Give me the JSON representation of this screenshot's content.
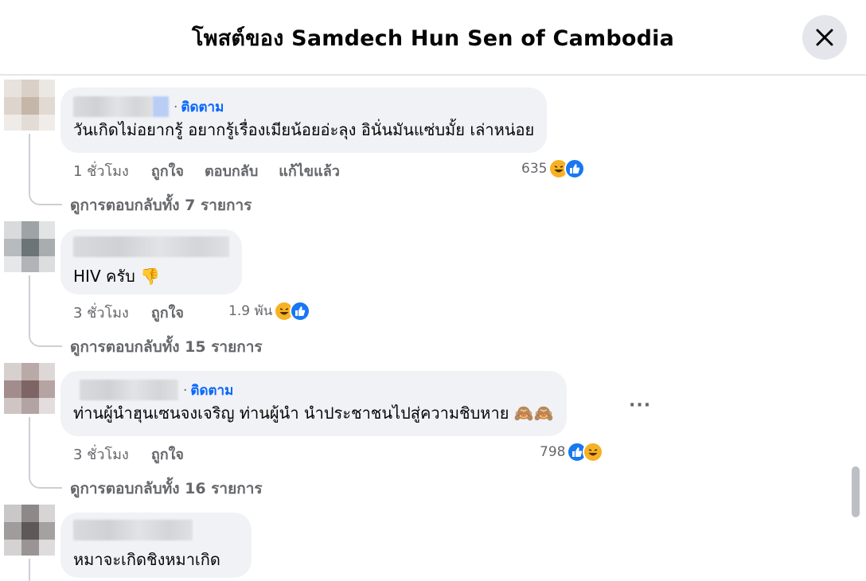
{
  "header": {
    "title": "โพสต์ของ Samdech Hun Sen of Cambodia",
    "close_icon": "close-icon"
  },
  "comments": [
    {
      "follow": "ติดตาม",
      "text": "วันเกิดไม่อยากรู้ อยากรู้เรื่องเมียน้อยอ่ะลุง อินั่นมันแซ่บมั้ย เล่าหน่อย",
      "time": "1 ชั่วโมง",
      "actions": [
        "ถูกใจ",
        "ตอบกลับ",
        "แก้ไขแล้ว"
      ],
      "reaction_count": "635",
      "reactions": [
        "haha",
        "like"
      ],
      "view_replies": "ดูการตอบกลับทั้ง 7 รายการ"
    },
    {
      "text": "HIV ครับ",
      "emoji": "👎",
      "time": "3 ชั่วโมง",
      "actions": [
        "ถูกใจ"
      ],
      "reaction_count": "1.9 พัน",
      "reactions": [
        "haha",
        "like"
      ],
      "view_replies": "ดูการตอบกลับทั้ง 15 รายการ"
    },
    {
      "follow": "ติดตาม",
      "text": "ท่านผู้นำฮุนเซนจงเจริญ ท่านผู้นำ นำประชาชนไปสู่ความชิบหาย",
      "emoji": "🙈🙈",
      "time": "3 ชั่วโมง",
      "actions": [
        "ถูกใจ"
      ],
      "reaction_count": "798",
      "reactions": [
        "like",
        "haha"
      ],
      "view_replies": "ดูการตอบกลับทั้ง 16 รายการ",
      "more": "···"
    },
    {
      "text": "หมาจะเกิดชิงหมาเกิด"
    }
  ],
  "colors": {
    "accent": "#0866ff",
    "bubble": "#f0f2f5",
    "secondary_text": "#65676b",
    "like": "#1877f2",
    "haha": "#f7b125"
  }
}
